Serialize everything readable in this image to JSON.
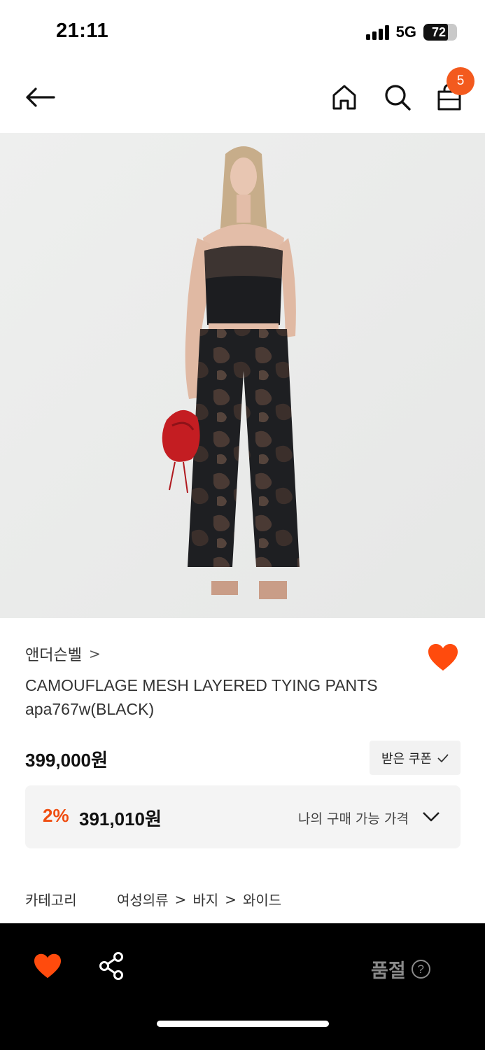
{
  "status_bar": {
    "time": "21:11",
    "network": "5G",
    "battery_level": 72,
    "battery_text": "72",
    "icons": [
      "signal-icon",
      "battery-icon"
    ]
  },
  "header": {
    "icons": [
      "back-arrow-icon",
      "home-icon",
      "search-icon",
      "shopping-bag-icon"
    ],
    "cart_count": "5",
    "accent_color": "#f35a1e"
  },
  "product": {
    "brand": "앤더슨벨",
    "brand_chevron": ">",
    "name_line1": "CAMOUFLAGE MESH LAYERED TYING PANTS",
    "name_line2": "apa767w(BLACK)",
    "price": "399,000원",
    "coupon_label": "받은 쿠폰",
    "discount_rate": "2%",
    "discount_price": "391,010원",
    "my_price_label": "나의 구매 가능 가격",
    "wishlisted": true,
    "heart_color": "#ff4b0d"
  },
  "category": {
    "label": "카테고리",
    "path": [
      "여성의류",
      "바지",
      "와이드"
    ],
    "separator": ">"
  },
  "bottom_bar": {
    "soldout_label": "품절",
    "help_symbol": "?",
    "icons": [
      "heart-icon",
      "share-icon",
      "help-icon"
    ]
  }
}
